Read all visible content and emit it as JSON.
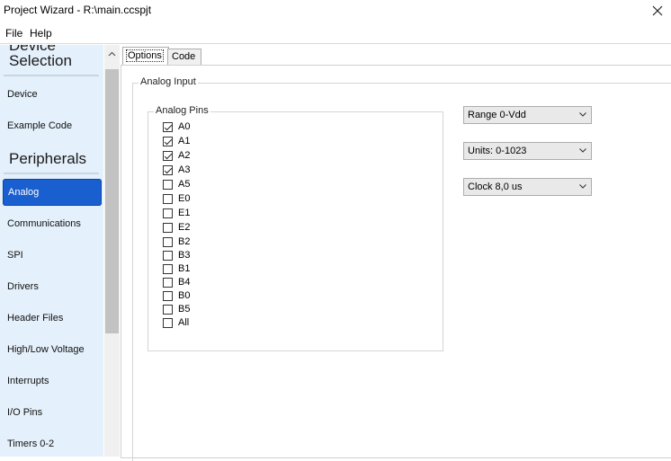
{
  "window": {
    "title": "Project Wizard - R:\\main.ccspjt"
  },
  "menu": {
    "items": [
      "File",
      "Help"
    ]
  },
  "sidebar": {
    "partial_header": "Device",
    "section1": "Selection",
    "section1_items": [
      "Device",
      "Example Code"
    ],
    "section2": "Peripherals",
    "selected": "Analog",
    "section2_items": [
      "Communications",
      "SPI",
      "Drivers",
      "Header Files",
      "High/Low Voltage",
      "Interrupts",
      "I/O Pins",
      "Timers 0-2"
    ]
  },
  "tabs": [
    {
      "label": "Options",
      "active": true
    },
    {
      "label": "Code",
      "active": false
    }
  ],
  "analog": {
    "group_title": "Analog Input",
    "pins_title": "Analog Pins",
    "pins": [
      {
        "label": "A0",
        "checked": true
      },
      {
        "label": "A1",
        "checked": true
      },
      {
        "label": "A2",
        "checked": true
      },
      {
        "label": "A3",
        "checked": true
      },
      {
        "label": "A5",
        "checked": false
      },
      {
        "label": "E0",
        "checked": false
      },
      {
        "label": "E1",
        "checked": false
      },
      {
        "label": "E2",
        "checked": false
      },
      {
        "label": "B2",
        "checked": false
      },
      {
        "label": "B3",
        "checked": false
      },
      {
        "label": "B1",
        "checked": false
      },
      {
        "label": "B4",
        "checked": false
      },
      {
        "label": "B0",
        "checked": false
      },
      {
        "label": "B5",
        "checked": false
      },
      {
        "label": "All",
        "checked": false
      }
    ],
    "range": "Range 0-Vdd",
    "units": "Units: 0-1023",
    "clock": "Clock 8,0 us"
  },
  "colors": {
    "sidebar_bg": "#e4f0fb",
    "selected_bg": "#1a5fd0"
  }
}
